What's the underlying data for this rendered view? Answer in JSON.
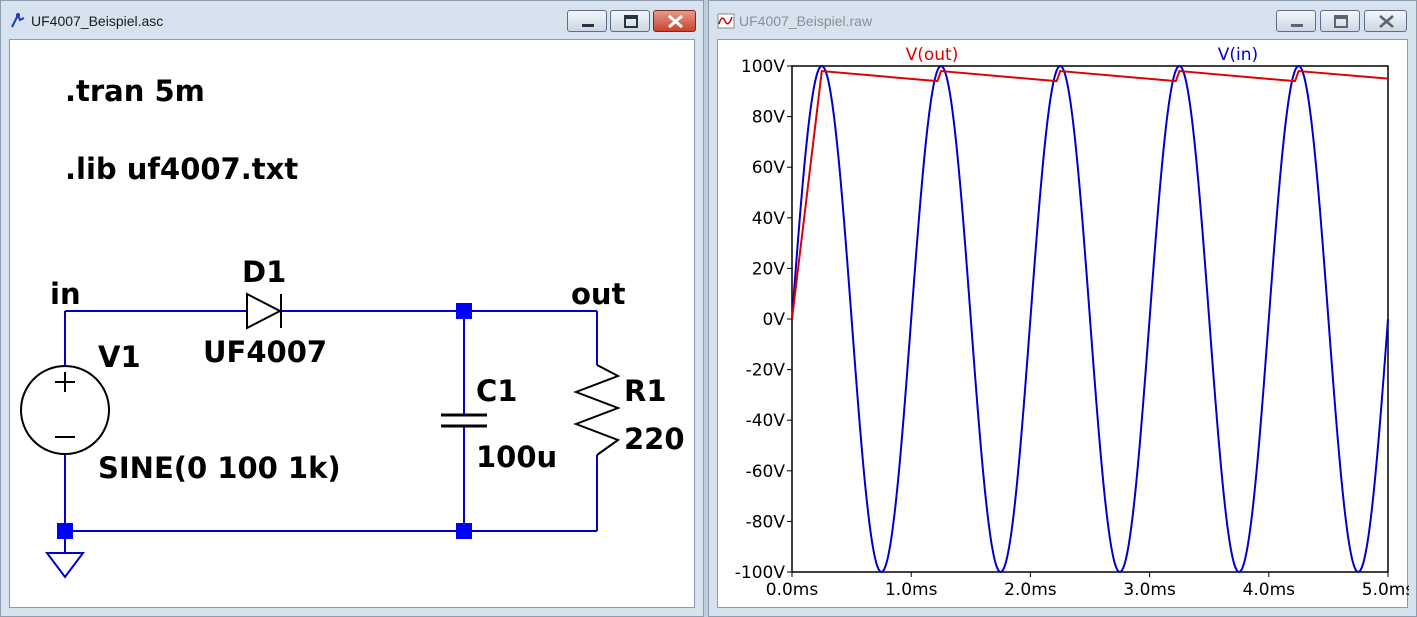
{
  "schematic_window": {
    "title": "UF4007_Beispiel.asc",
    "directives": [
      ".tran 5m",
      ".lib uf4007.txt"
    ],
    "nets": {
      "input": "in",
      "output": "out"
    },
    "components": {
      "source": {
        "name": "V1",
        "value": "SINE(0 100 1k)"
      },
      "diode": {
        "name": "D1",
        "value": "UF4007"
      },
      "capacitor": {
        "name": "C1",
        "value": "100u"
      },
      "resistor": {
        "name": "R1",
        "value": "220"
      }
    },
    "wire_color": "#0000cc",
    "node_color": "#0000ff"
  },
  "plot_window": {
    "title": "UF4007_Beispiel.raw",
    "chart_data": {
      "type": "line",
      "xlabel": "",
      "ylabel": "",
      "xlim": [
        0,
        5
      ],
      "ylim": [
        -100,
        100
      ],
      "x_unit": "ms",
      "y_unit": "V",
      "x_ticks": [
        "0.0ms",
        "1.0ms",
        "2.0ms",
        "3.0ms",
        "4.0ms",
        "5.0ms"
      ],
      "y_ticks": [
        "100V",
        "80V",
        "60V",
        "40V",
        "20V",
        "0V",
        "-20V",
        "-40V",
        "-60V",
        "-80V",
        "-100V"
      ],
      "grid": true,
      "legend_position": "top",
      "series": [
        {
          "name": "V(out)",
          "color": "#dd0000",
          "x": [
            0,
            0.25,
            1.22,
            1.25,
            2.22,
            2.25,
            3.22,
            3.25,
            4.22,
            4.25,
            5.0
          ],
          "y": [
            0,
            98,
            94,
            98,
            94,
            98,
            94,
            98,
            94,
            98,
            95
          ]
        },
        {
          "name": "V(in)",
          "color": "#0000cc",
          "function": "100*sin(2*pi*1*t)",
          "x": [
            0,
            0.25,
            0.5,
            0.75,
            1.0,
            1.25,
            1.5,
            1.75,
            2.0,
            2.25,
            2.5,
            2.75,
            3.0,
            3.25,
            3.5,
            3.75,
            4.0,
            4.25,
            4.5,
            4.75,
            5.0
          ],
          "y": [
            0,
            100,
            0,
            -100,
            0,
            100,
            0,
            -100,
            0,
            100,
            0,
            -100,
            0,
            100,
            0,
            -100,
            0,
            100,
            0,
            -100,
            0
          ]
        }
      ]
    }
  }
}
